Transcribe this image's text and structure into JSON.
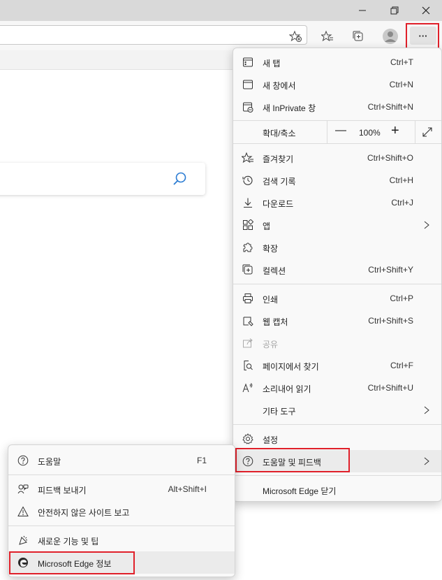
{
  "window": {
    "controls": {
      "minimize": "minimize-icon",
      "restore": "restore-icon",
      "close": "close-icon"
    }
  },
  "toolbar": {
    "icons": [
      "add-favorite-icon",
      "favorites-icon",
      "collections-icon",
      "profile-avatar",
      "more-icon"
    ],
    "more_label": "···"
  },
  "main_menu": {
    "items": {
      "new_tab": {
        "label": "새 탭",
        "shortcut": "Ctrl+T",
        "icon": "new-tab-icon"
      },
      "new_window": {
        "label": "새 창에서",
        "shortcut": "Ctrl+N",
        "icon": "new-window-icon"
      },
      "new_inprivate": {
        "label": "새 InPrivate 창",
        "shortcut": "Ctrl+Shift+N",
        "icon": "inprivate-icon"
      },
      "zoom": {
        "label": "확대/축소",
        "value": "100%",
        "minus": "—",
        "plus": "+"
      },
      "favorites": {
        "label": "즐겨찾기",
        "shortcut": "Ctrl+Shift+O",
        "icon": "favorites-icon"
      },
      "history": {
        "label": "검색 기록",
        "shortcut": "Ctrl+H",
        "icon": "history-icon"
      },
      "downloads": {
        "label": "다운로드",
        "shortcut": "Ctrl+J",
        "icon": "download-icon"
      },
      "apps": {
        "label": "앱",
        "icon": "apps-icon"
      },
      "extensions": {
        "label": "확장",
        "icon": "extensions-icon"
      },
      "collections": {
        "label": "컬렉션",
        "shortcut": "Ctrl+Shift+Y",
        "icon": "collections-icon"
      },
      "print": {
        "label": "인쇄",
        "shortcut": "Ctrl+P",
        "icon": "print-icon"
      },
      "web_capture": {
        "label": "웹 캡처",
        "shortcut": "Ctrl+Shift+S",
        "icon": "web-capture-icon"
      },
      "share": {
        "label": "공유",
        "icon": "share-icon",
        "disabled": true
      },
      "find": {
        "label": "페이지에서 찾기",
        "shortcut": "Ctrl+F",
        "icon": "find-icon"
      },
      "read_aloud": {
        "label": "소리내어 읽기",
        "shortcut": "Ctrl+Shift+U",
        "icon": "read-aloud-icon"
      },
      "more_tools": {
        "label": "기타 도구"
      },
      "settings": {
        "label": "설정",
        "icon": "settings-icon"
      },
      "help_feedback": {
        "label": "도움말 및 피드백",
        "icon": "help-icon"
      },
      "close_edge": {
        "label": "Microsoft Edge 닫기"
      }
    }
  },
  "help_menu": {
    "items": {
      "help": {
        "label": "도움말",
        "shortcut": "F1",
        "icon": "help-icon"
      },
      "feedback": {
        "label": "피드백 보내기",
        "shortcut": "Alt+Shift+I",
        "icon": "feedback-icon"
      },
      "report_unsafe": {
        "label": "안전하지 않은 사이트 보고",
        "icon": "warning-icon"
      },
      "whats_new": {
        "label": "새로운 기능 및 팁",
        "icon": "whats-new-icon"
      },
      "about": {
        "label": "Microsoft Edge 정보",
        "icon": "edge-logo-icon"
      }
    }
  },
  "colors": {
    "highlight_box": "#e0202a",
    "menu_bg": "#f9f9f9",
    "hover": "#ebebeb"
  }
}
